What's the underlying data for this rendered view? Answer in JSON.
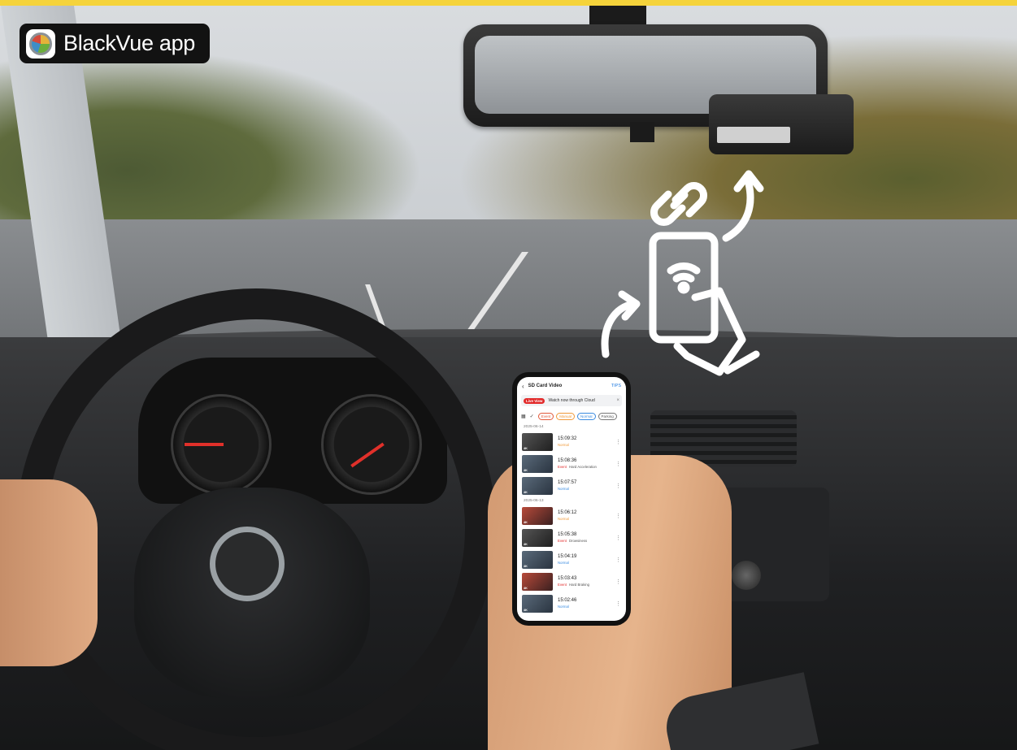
{
  "badge": {
    "text": "BlackVue app"
  },
  "phone": {
    "header": {
      "title": "SD Card Video",
      "tips": "TIPS"
    },
    "cloud_banner": {
      "live_label": "Live View",
      "text": "Watch now through Cloud"
    },
    "filters": [
      "Event",
      "Manual",
      "Normal",
      "Parking"
    ],
    "groups": [
      {
        "date": "2025-06-14",
        "items": [
          {
            "time": "15:09:32",
            "tag": "Normal",
            "tag_kind": "normal",
            "desc": ""
          },
          {
            "time": "15:08:36",
            "tag": "Event",
            "tag_kind": "event",
            "desc": "Hard Acceleration"
          },
          {
            "time": "15:07:57",
            "tag": "Normal",
            "tag_kind": "normal2",
            "desc": ""
          }
        ]
      },
      {
        "date": "2025-06-13",
        "items": [
          {
            "time": "15:06:12",
            "tag": "Normal",
            "tag_kind": "normal",
            "desc": ""
          },
          {
            "time": "15:05:38",
            "tag": "Event",
            "tag_kind": "event",
            "desc": "Drowsiness"
          },
          {
            "time": "15:04:19",
            "tag": "Normal",
            "tag_kind": "normal2",
            "desc": ""
          },
          {
            "time": "15:03:43",
            "tag": "Event",
            "tag_kind": "event",
            "desc": "Hard Braking"
          },
          {
            "time": "15:02:46",
            "tag": "Normal",
            "tag_kind": "normal2",
            "desc": ""
          }
        ]
      }
    ],
    "thumb_badge": "4K"
  },
  "colors": {
    "accent_bar": "#f5d33b",
    "badge_bg": "#121212",
    "live_red": "#e22a2a",
    "tips_blue": "#1f7ae0"
  },
  "icons": [
    "chain-link-icon",
    "phone-wifi-hand-icon",
    "curved-arrow-up-icon",
    "curved-arrow-icon"
  ]
}
